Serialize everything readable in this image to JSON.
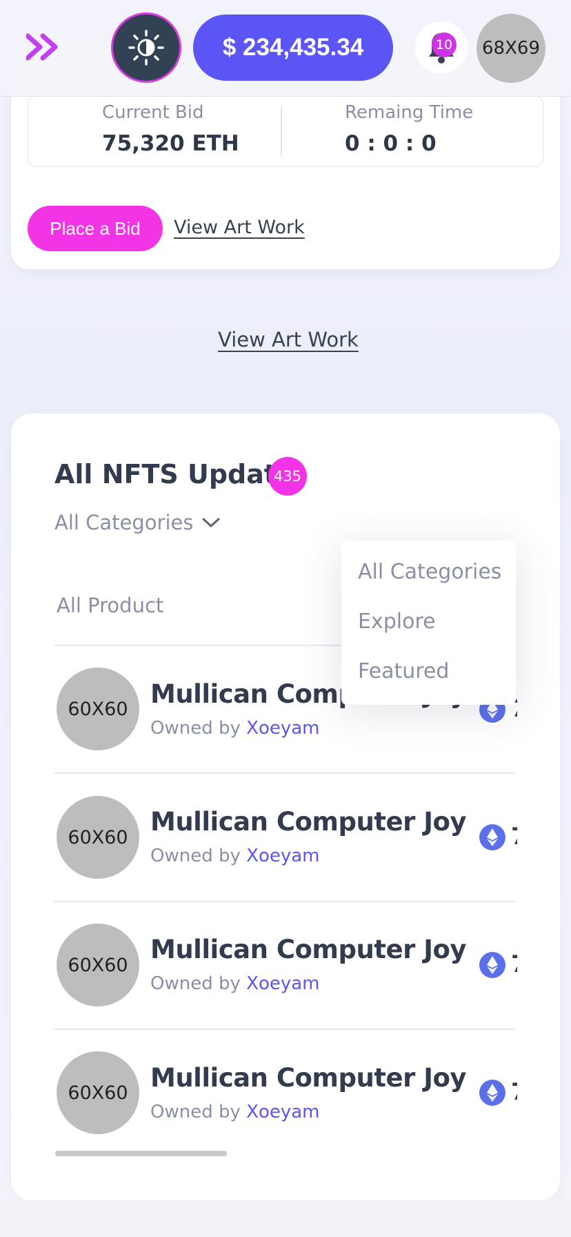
{
  "header": {
    "ghost_text": "",
    "balance": "$ 234,435.34",
    "notification_count": "10",
    "avatar_placeholder": "68X69",
    "colors": {
      "accent": "#5a55f4",
      "pink": "#f233e6",
      "dark": "#334155"
    },
    "icons": [
      "chevrons-right-icon",
      "sun-icon",
      "bell-icon"
    ]
  },
  "bid_card": {
    "current_bid_label": "Current Bid",
    "current_bid_value": "75,320 ETH",
    "remaining_label": "Remaing Time",
    "remaining_value": "0 : 0 : 0",
    "place_bid_label": "Place a Bid",
    "view_art_label": "View Art Work"
  },
  "view_art_center": "View Art Work",
  "nfts": {
    "title": "All NFTS Update",
    "count": "435",
    "category_selected": "All Categories",
    "dropdown_options": [
      "All Categories",
      "Explore",
      "Featured"
    ],
    "tab_label": "All Product",
    "rows": [
      {
        "avatar": "60X60",
        "name": "Mullican Computer Joy",
        "owned_prefix": "Owned by",
        "owner": "Xoeyam",
        "price_fragment": "7"
      },
      {
        "avatar": "60X60",
        "name": "Mullican Computer Joy",
        "owned_prefix": "Owned by",
        "owner": "Xoeyam",
        "price_fragment": "7"
      },
      {
        "avatar": "60X60",
        "name": "Mullican Computer Joy",
        "owned_prefix": "Owned by",
        "owner": "Xoeyam",
        "price_fragment": "7"
      },
      {
        "avatar": "60X60",
        "name": "Mullican Computer Joy",
        "owned_prefix": "Owned by",
        "owner": "Xoeyam",
        "price_fragment": "7"
      }
    ]
  }
}
